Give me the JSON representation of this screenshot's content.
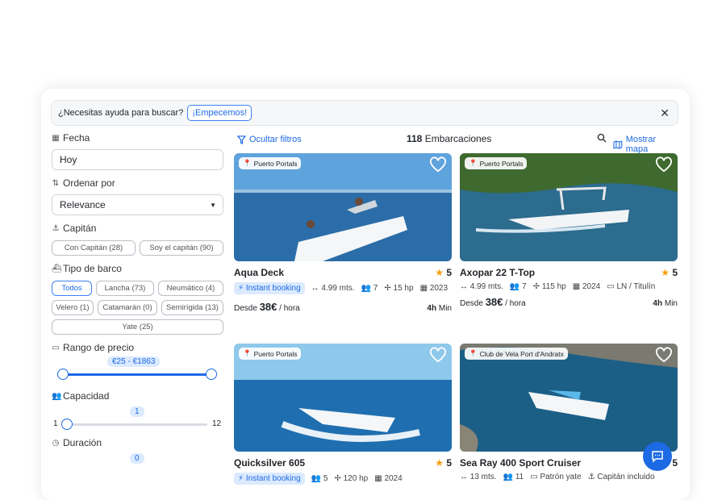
{
  "help_bar": {
    "question": "¿Necesitas ayuda para buscar?",
    "cta": "¡Empecemos!",
    "close": "✕"
  },
  "filters": {
    "date_label": "Fecha",
    "date_value": "Hoy",
    "sort_label": "Ordenar por",
    "sort_value": "Relevance",
    "captain_label": "Capitán",
    "captain_options": [
      "Con Capitán (28)",
      "Soy el capitán (90)"
    ],
    "boat_type_label": "Tipo de barco",
    "boat_types": [
      "Todos",
      "Lancha (73)",
      "Neumático (4)",
      "Velero (1)",
      "Catamarán (0)",
      "Semirígida (13)",
      "Yate (25)"
    ],
    "price_label": "Rango de precio",
    "price_range": "€25  -  €1863",
    "capacity_label": "Capacidad",
    "capacity_value": "1",
    "capacity_min": "1",
    "capacity_max": "12",
    "duration_label": "Duración",
    "duration_value": "0"
  },
  "toolbar": {
    "hide_filters": "Ocultar filtros",
    "count": "118",
    "count_label": "Embarcaciones",
    "show_map": "Mostrar mapa"
  },
  "boats": [
    {
      "location": "Puerto Portals",
      "name": "Aqua Deck",
      "rating": "5",
      "instant": "Instant booking",
      "length": "4.99 mts.",
      "people": "7",
      "hp": "15 hp",
      "year": "2023",
      "from": "Desde",
      "price": "38€",
      "per": "/ hora",
      "min_hours": "4h",
      "min_label": "Min"
    },
    {
      "location": "Puerto Portals",
      "name": "Axopar 22 T-Top",
      "rating": "5",
      "length": "4.99 mts.",
      "people": "7",
      "hp": "115 hp",
      "year": "2024",
      "license": "LN / Titulín",
      "from": "Desde",
      "price": "38€",
      "per": "/ hora",
      "min_hours": "4h",
      "min_label": "Min"
    },
    {
      "location": "Puerto Portals",
      "name": "Quicksilver 605",
      "rating": "5",
      "instant": "Instant booking",
      "people": "5",
      "hp": "120 hp",
      "year": "2024"
    },
    {
      "location": "Club de Vela Port d'Andratx",
      "name": "Sea Ray 400 Sport Cruiser",
      "rating": "5",
      "length": "13 mts.",
      "people": "11",
      "skipper": "Patrón yate",
      "captain": "Capitán incluido"
    }
  ],
  "colors": {
    "accent": "#1d6ae5",
    "accent_light": "#dbeafe",
    "star": "#f59e0b"
  }
}
